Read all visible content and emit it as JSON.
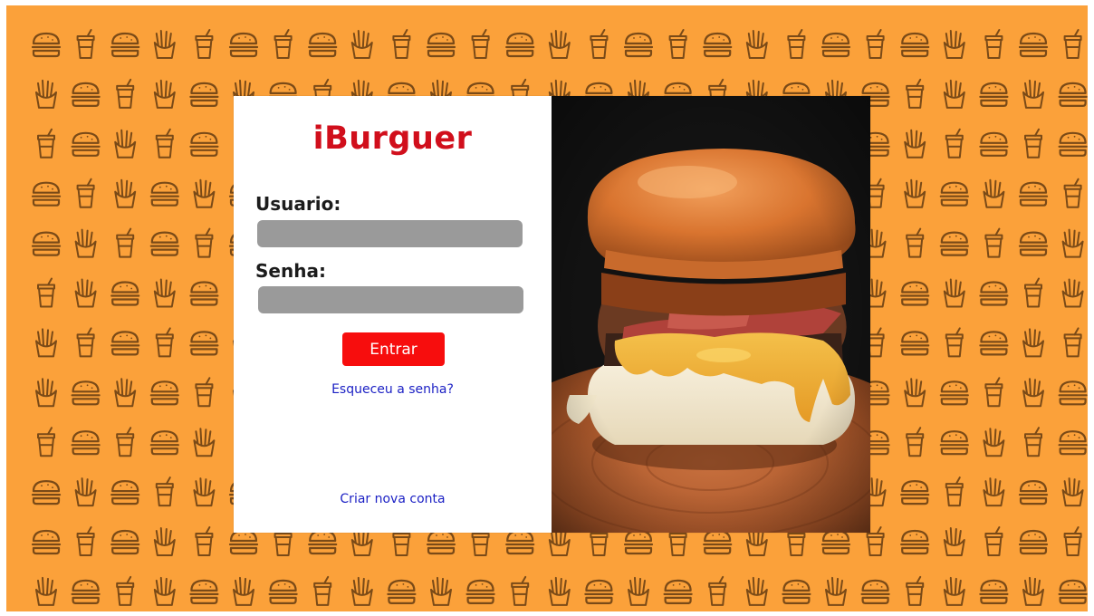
{
  "app": {
    "logo_text": "iBurguer",
    "brand_color": "#d10f1c",
    "background_color": "#fba13a",
    "pattern_color": "#7a4a17",
    "pattern_icons": [
      "hamburger-icon",
      "fries-icon",
      "soda-cup-icon"
    ]
  },
  "login": {
    "username_label": "Usuario:",
    "username_value": "",
    "password_label": "Senha:",
    "password_value": "",
    "submit_label": "Entrar",
    "submit_color": "#f70d0d",
    "forgot_password_link": "Esqueceu a senha?",
    "create_account_link": "Criar nova conta",
    "link_color": "#1a1fc4"
  },
  "photo": {
    "subject": "burger-photo"
  }
}
